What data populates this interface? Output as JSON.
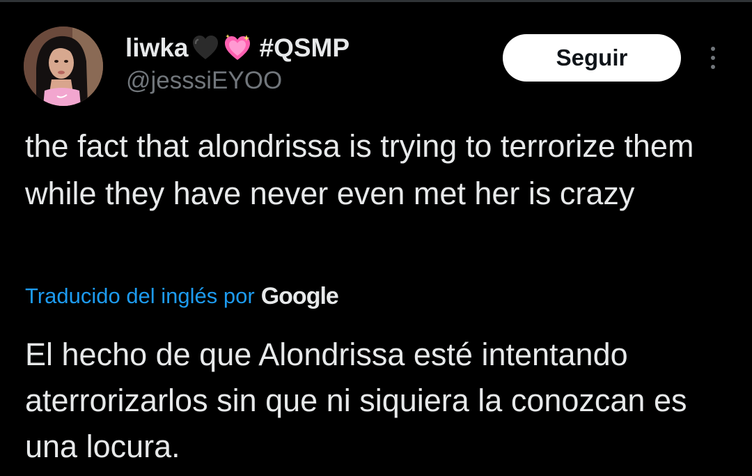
{
  "author": {
    "display_name": "liwka",
    "emoji_1": "black-heart",
    "emoji_2": "sparkling-heart",
    "hashtag": "#QSMP",
    "handle": "@jesssiEYOO"
  },
  "follow_button": {
    "label": "Seguir"
  },
  "menu": {
    "icon": "more-vertical-icon"
  },
  "tweet": {
    "text": "the fact that alondrissa is trying to terrorize them while they have never even met her is crazy"
  },
  "translation": {
    "link_text": "Traducido del inglés por",
    "provider": "Google",
    "text": "El hecho de que Alondrissa esté intentando aterrorizarlos sin que ni siquiera la conozcan es una locura."
  },
  "colors": {
    "background": "#000000",
    "text": "#e7e9ea",
    "secondary_text": "#71767b",
    "link": "#1d9bf0",
    "button_bg": "#ffffff",
    "button_text": "#0f1419"
  }
}
